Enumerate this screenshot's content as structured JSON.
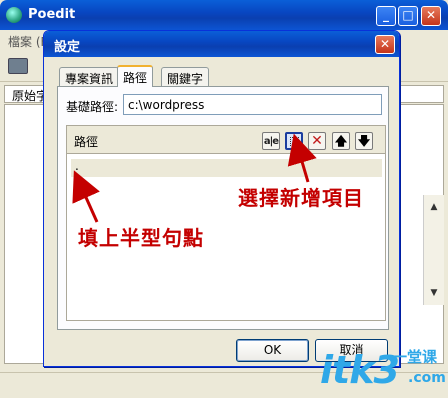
{
  "app": {
    "title": "Poedit",
    "menu": [
      "檔案 (F"
    ],
    "list_column": "原始字"
  },
  "dialog": {
    "title": "設定",
    "tabs": [
      "專案資訊",
      "路徑",
      "關鍵字"
    ],
    "active_tab": "路徑",
    "base_path_label": "基礎路徑:",
    "base_path_value": "c:\\wordpress",
    "paths_label": "路徑",
    "path_entries": [
      "."
    ],
    "toolbar_buttons": [
      "edit-icon",
      "new-item-icon",
      "delete-icon",
      "move-up-icon",
      "move-down-icon"
    ],
    "ok_label": "OK",
    "cancel_label": "取消"
  },
  "annotations": {
    "select_new": "選擇新增項目",
    "fill_dot": "填上半型句點",
    "color": "#c40000"
  },
  "watermark": {
    "text": "itk3",
    "cn": "一堂课",
    "suffix": ".com"
  }
}
